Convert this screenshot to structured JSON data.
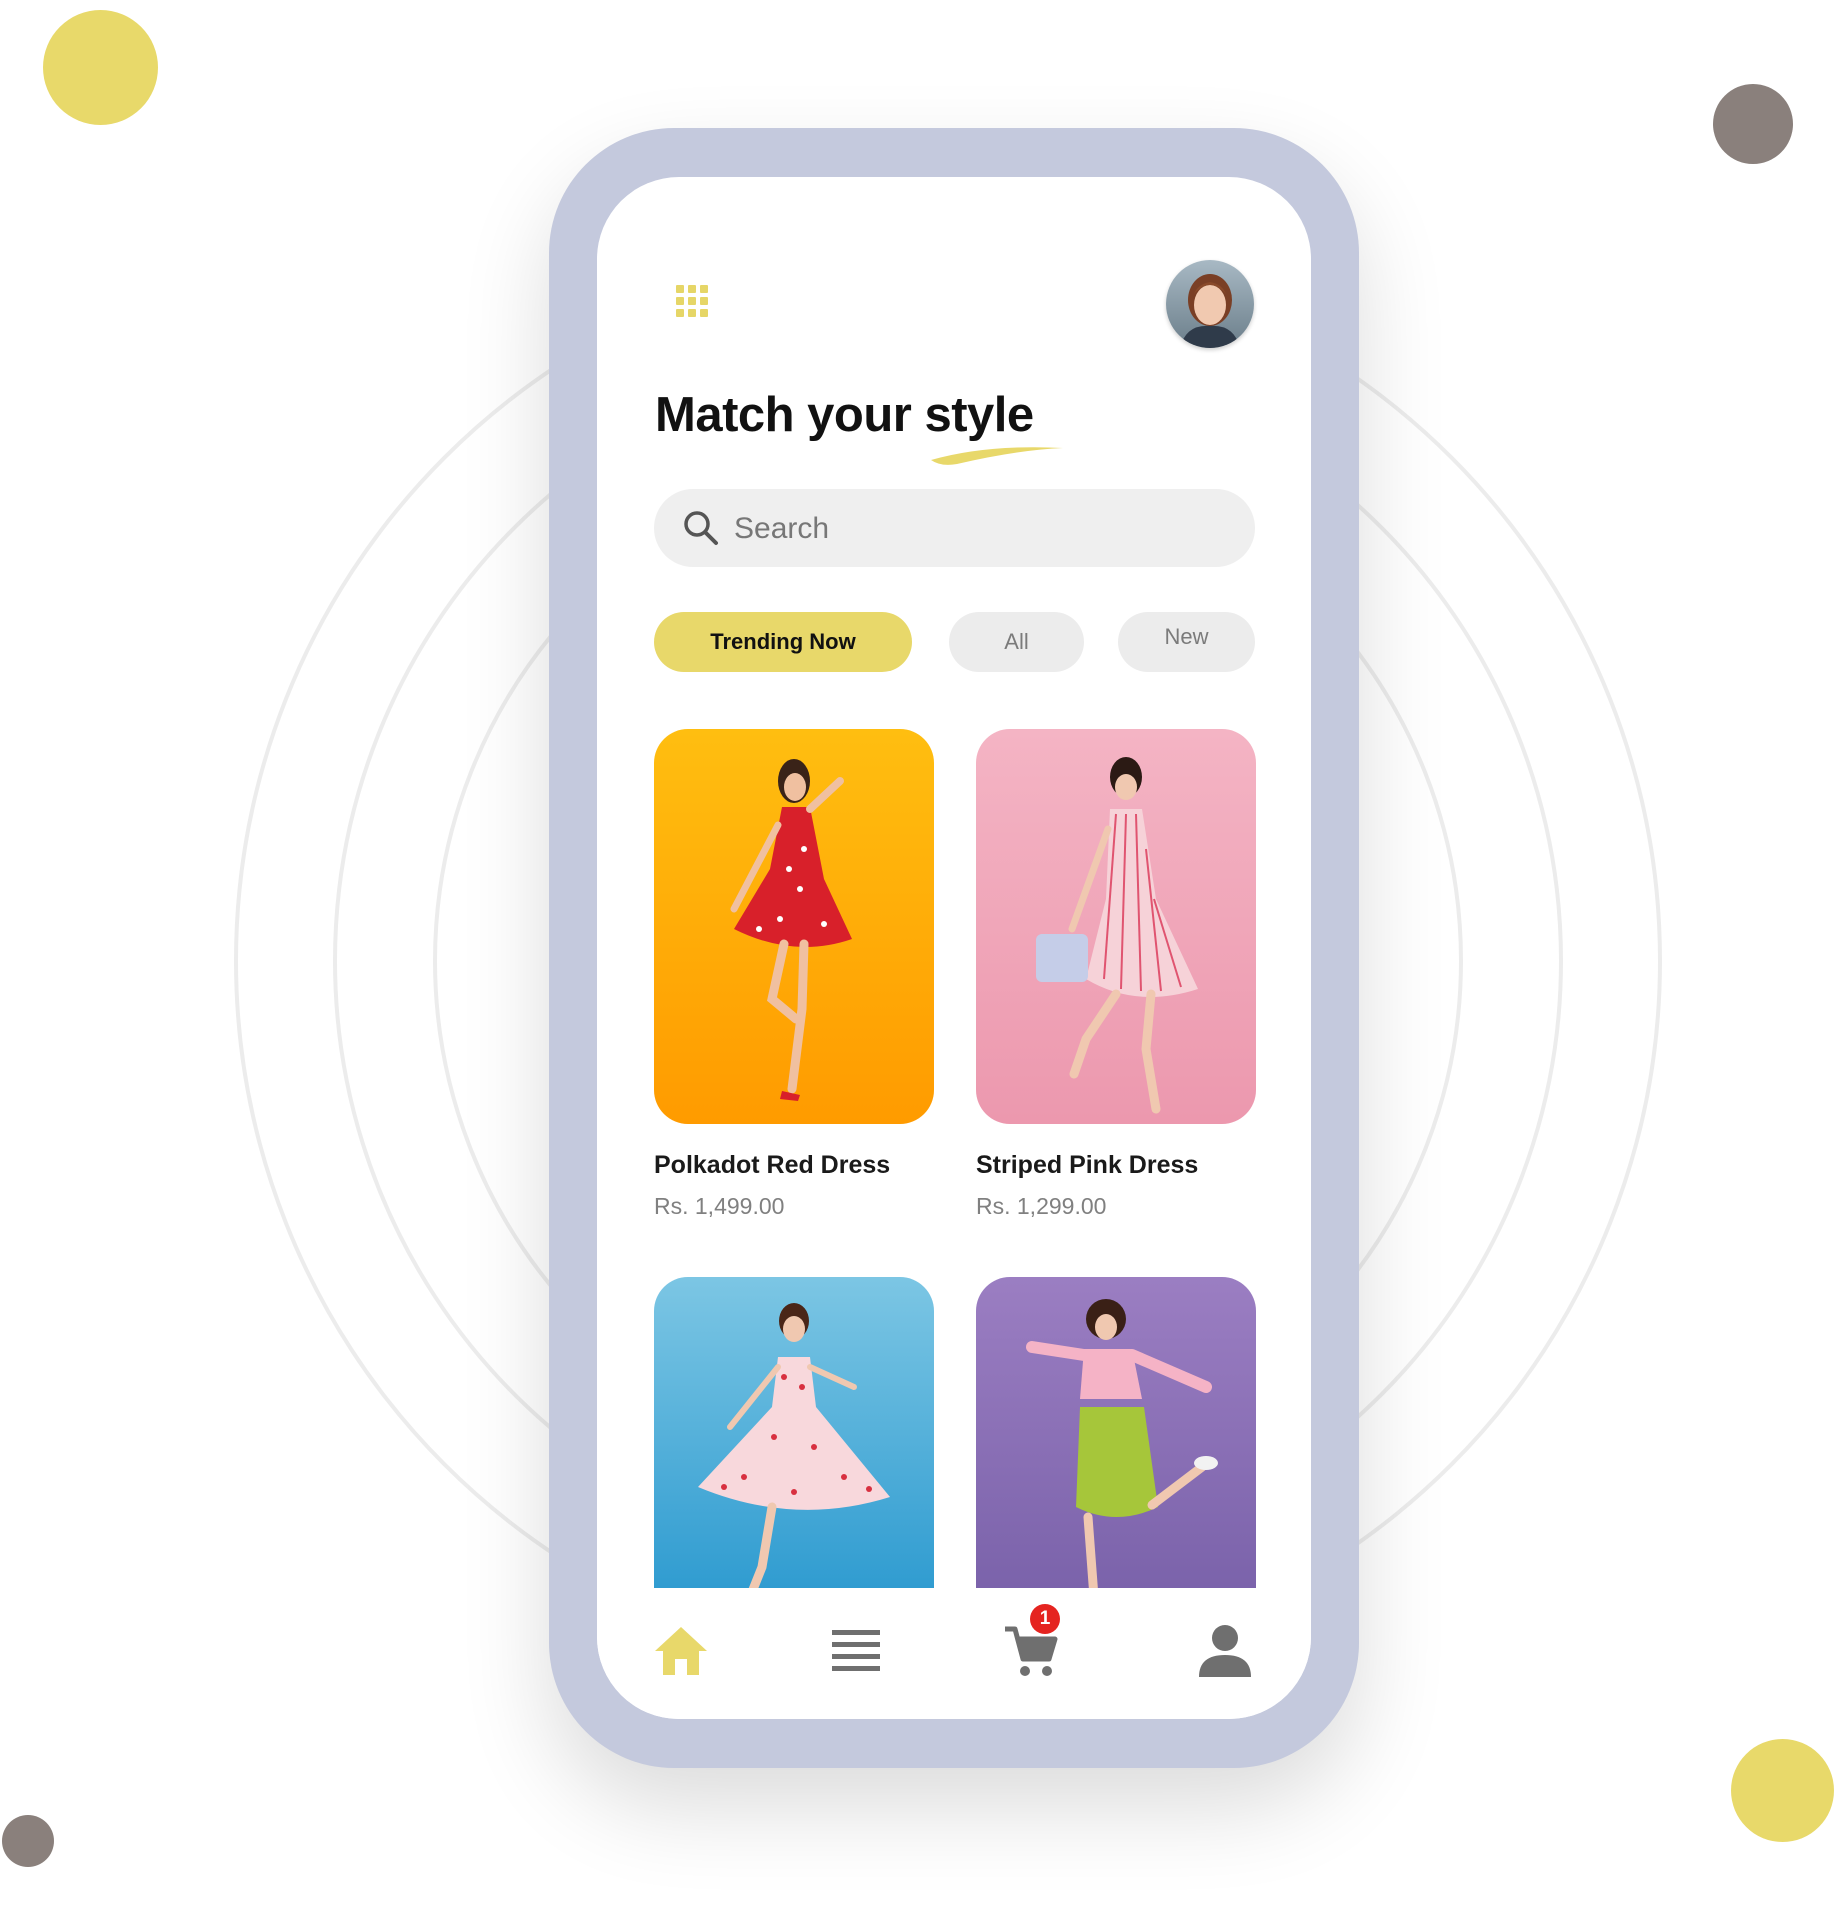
{
  "header": {
    "title": "Match your style",
    "menu_icon": "grid-menu-icon",
    "avatar": "profile-avatar"
  },
  "search": {
    "placeholder": "Search",
    "value": "",
    "icon": "search-icon"
  },
  "filters": [
    {
      "label": "Trending Now",
      "active": true
    },
    {
      "label": "All",
      "active": false
    },
    {
      "label": "New",
      "active": false
    }
  ],
  "products": [
    {
      "name": "Polkadot Red Dress",
      "price": "Rs.  1,499.00",
      "background": "#ffb000"
    },
    {
      "name": "Striped Pink Dress",
      "price": "Rs.  1,299.00",
      "background": "#f2a6b8"
    },
    {
      "name": "",
      "price": "",
      "background": "#4aaad4"
    },
    {
      "name": "",
      "price": "",
      "background": "#8c74b4"
    }
  ],
  "bottom_nav": {
    "items": [
      {
        "icon": "home-icon",
        "active": true
      },
      {
        "icon": "list-icon",
        "active": false
      },
      {
        "icon": "cart-icon",
        "active": false
      },
      {
        "icon": "user-icon",
        "active": false
      }
    ],
    "cart_badge": "1"
  },
  "colors": {
    "accent": "#e8d86a",
    "phone_frame": "#c4c9dd",
    "badge": "#e52420",
    "dot_gray": "#8a807c"
  }
}
